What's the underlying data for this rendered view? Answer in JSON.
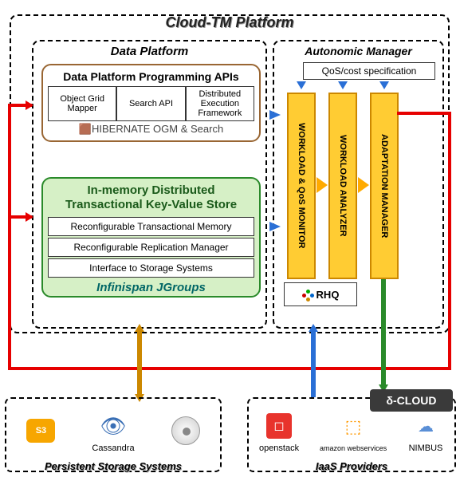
{
  "outer_title": "Cloud-TM Platform",
  "data_platform": {
    "title": "Data Platform",
    "api_header": "Data Platform Programming APIs",
    "api_cells": [
      "Object Grid Mapper",
      "Search API",
      "Distributed Execution Framework"
    ],
    "api_tech": "HIBERNATE OGM & Search",
    "kv_header": "In-memory Distributed Transactional Key-Value Store",
    "kv_rows": [
      "Reconfigurable Transactional Memory",
      "Reconfigurable Replication Manager",
      "Interface to Storage Systems"
    ],
    "kv_tech": "Infinispan   JGroups"
  },
  "autonomic_manager": {
    "title": "Autonomic Manager",
    "qos_label": "QoS/cost specification",
    "columns": [
      "WORKLOAD & QoS MONITOR",
      "WORKLOAD ANALYZER",
      "ADAPTATION MANAGER"
    ],
    "rhq_label": "RHQ"
  },
  "bottom_left": {
    "title": "Persistent Storage Systems",
    "items": [
      "S3",
      "Cassandra",
      ""
    ]
  },
  "bottom_right": {
    "title": "IaaS Providers",
    "deltacloud": "δ-CLOUD",
    "items": [
      "openstack",
      "amazon webservices",
      "NIMBUS"
    ]
  }
}
